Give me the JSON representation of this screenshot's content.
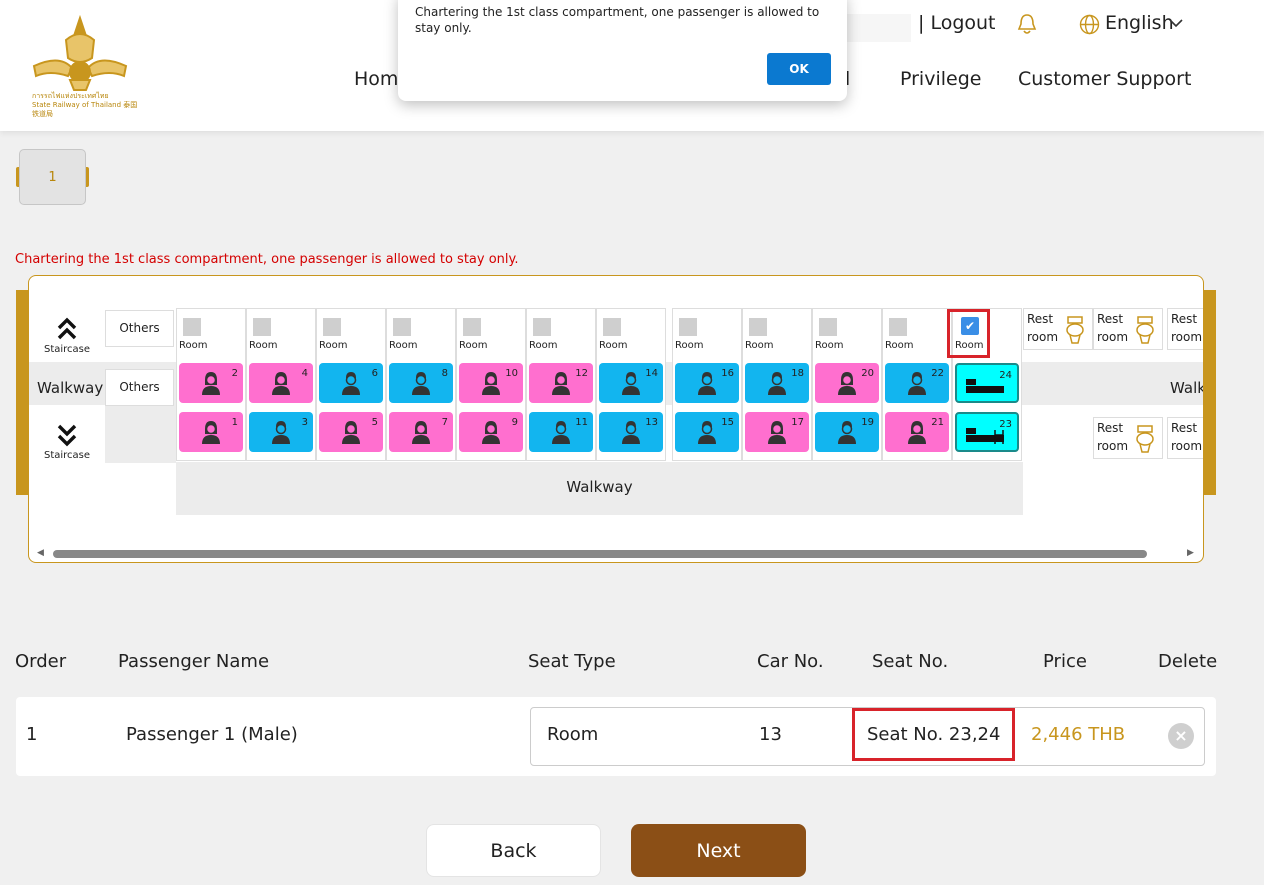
{
  "header": {
    "logo_text_th": "การรถไฟแห่งประเทศไทย",
    "logo_text_en": "State Railway of Thailand 泰国铁道局",
    "logout": "| Logout",
    "language": "English",
    "nav": [
      "Home",
      "Privilege",
      "Customer Support"
    ],
    "nav_partial": "l"
  },
  "alert": {
    "message": "Chartering the 1st class compartment, one passenger is allowed to stay only.",
    "ok_label": "OK"
  },
  "car_tabs": [
    "1"
  ],
  "warning": "Chartering the 1st class compartment, one passenger is allowed to stay only.",
  "seat_map": {
    "staircase_label": "Staircase",
    "walkway_label": "Walkway",
    "walkway_right_label": "Walk",
    "others_label": "Others",
    "room_label": "Room",
    "rest_room_line1": "Rest",
    "rest_room_line2": "room",
    "compartments": [
      {
        "upper": "2",
        "upper_type": "female",
        "lower": "1",
        "lower_type": "female"
      },
      {
        "upper": "4",
        "upper_type": "female",
        "lower": "3",
        "lower_type": "male"
      },
      {
        "upper": "6",
        "upper_type": "male",
        "lower": "5",
        "lower_type": "female"
      },
      {
        "upper": "8",
        "upper_type": "male",
        "lower": "7",
        "lower_type": "female"
      },
      {
        "upper": "10",
        "upper_type": "female",
        "lower": "9",
        "lower_type": "female"
      },
      {
        "upper": "12",
        "upper_type": "female",
        "lower": "11",
        "lower_type": "male"
      },
      {
        "upper": "14",
        "upper_type": "male",
        "lower": "13",
        "lower_type": "male"
      },
      {
        "upper": "16",
        "upper_type": "male",
        "lower": "15",
        "lower_type": "male"
      },
      {
        "upper": "18",
        "upper_type": "male",
        "lower": "17",
        "lower_type": "female"
      },
      {
        "upper": "20",
        "upper_type": "female",
        "lower": "19",
        "lower_type": "male"
      },
      {
        "upper": "22",
        "upper_type": "male",
        "lower": "21",
        "lower_type": "female"
      },
      {
        "upper": "24",
        "upper_type": "selected",
        "lower": "23",
        "lower_type": "selected"
      }
    ],
    "colors": {
      "female": "#ff6fcf",
      "male": "#12b5ef",
      "selected": "#00ffff",
      "highlight": "#d8232a"
    }
  },
  "table": {
    "headers": {
      "order": "Order",
      "passenger_name": "Passenger Name",
      "seat_type": "Seat Type",
      "car_no": "Car No.",
      "seat_no": "Seat No.",
      "price": "Price",
      "delete": "Delete"
    },
    "rows": [
      {
        "order": "1",
        "passenger_name": "Passenger 1 (Male)",
        "seat_type": "Room",
        "car_no": "13",
        "seat_no": "Seat No. 23,24",
        "price": "2,446 THB"
      }
    ]
  },
  "buttons": {
    "back": "Back",
    "next": "Next"
  }
}
